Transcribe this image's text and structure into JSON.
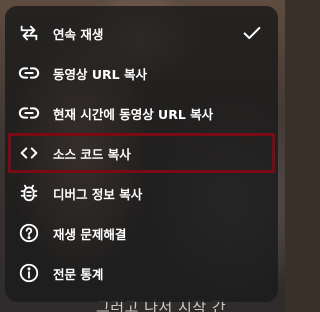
{
  "menu": {
    "items": [
      {
        "label": "연속 재생",
        "icon": "autoplay-icon",
        "checked": true
      },
      {
        "label": "동영상 URL 복사",
        "icon": "link-icon"
      },
      {
        "label": "현재 시간에 동영상 URL 복사",
        "icon": "link-icon"
      },
      {
        "label": "소스 코드 복사",
        "icon": "code-icon",
        "highlighted": true,
        "highlight_color": "#7a0a14"
      },
      {
        "label": "디버그 정보 복사",
        "icon": "bug-icon"
      },
      {
        "label": "재생 문제해결",
        "icon": "help-icon"
      },
      {
        "label": "전문 통계",
        "icon": "info-icon"
      }
    ]
  },
  "video": {
    "caption": "그러고 나서 시작 간"
  }
}
